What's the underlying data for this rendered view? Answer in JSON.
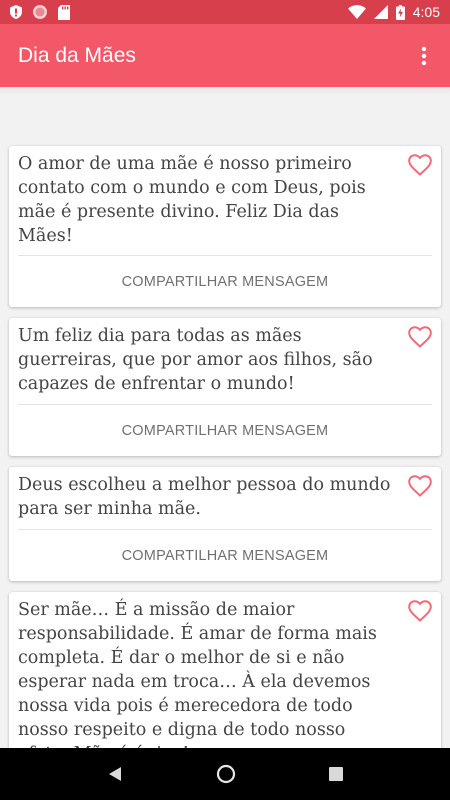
{
  "status_bar": {
    "time": "4:05",
    "left_icons": [
      "shield-icon",
      "record-icon",
      "sd-card-icon"
    ],
    "right_icons": [
      "wifi-icon",
      "signal-icon",
      "battery-charging-icon"
    ]
  },
  "app_bar": {
    "title": "Dia da Mães",
    "menu_icon": "more-vert-icon",
    "background_color": "#f25868",
    "status_color": "#d63f4b"
  },
  "cards": [
    {
      "text": "O amor de uma mãe é nosso primeiro contato com o mundo e com Deus, pois mãe é presente divino. Feliz Dia das Mães!",
      "share_label": "COMPARTILHAR MENSAGEM",
      "favorite_icon": "heart-outline-icon"
    },
    {
      "text": "Um feliz dia para todas as mães guerreiras, que por amor aos filhos, são capazes de enfrentar o mundo!",
      "share_label": "COMPARTILHAR MENSAGEM",
      "favorite_icon": "heart-outline-icon"
    },
    {
      "text": "Deus escolheu a melhor pessoa do mundo para ser minha mãe.",
      "share_label": "COMPARTILHAR MENSAGEM",
      "favorite_icon": "heart-outline-icon"
    },
    {
      "text": "Ser mãe… É a missão de maior responsabilidade. É amar de forma mais completa. É dar o melhor de si e não esperar nada em troca… À ela devemos nossa vida pois é merecedora de todo nosso respeito e digna de todo nosso afeto. Mãe é única!",
      "favorite_icon": "heart-outline-icon"
    }
  ],
  "nav_bar": {
    "icons": [
      "back-icon",
      "home-icon",
      "recents-icon"
    ]
  },
  "colors": {
    "heart": "#f06a7c",
    "quote_text": "#444444",
    "share_text": "#707070"
  }
}
